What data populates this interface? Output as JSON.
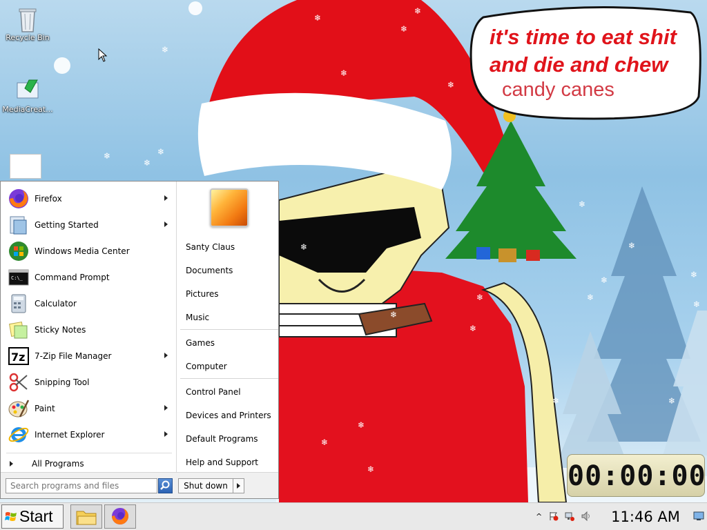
{
  "desktop": {
    "icons": [
      {
        "label": "Recycle Bin"
      },
      {
        "label": "MediaCreat..."
      }
    ],
    "speech_bubble": {
      "line1": "it's time to eat shit",
      "line2": "and die and chew",
      "line3": "candy canes"
    },
    "timer_gadget": {
      "display": "00:00:00"
    }
  },
  "start_menu": {
    "programs": [
      {
        "label": "Firefox",
        "submenu": true
      },
      {
        "label": "Getting Started",
        "submenu": true
      },
      {
        "label": "Windows Media Center",
        "submenu": false
      },
      {
        "label": "Command Prompt",
        "submenu": false
      },
      {
        "label": "Calculator",
        "submenu": false
      },
      {
        "label": "Sticky Notes",
        "submenu": false
      },
      {
        "label": "7-Zip File Manager",
        "submenu": true
      },
      {
        "label": "Snipping Tool",
        "submenu": false
      },
      {
        "label": "Paint",
        "submenu": true
      },
      {
        "label": "Internet Explorer",
        "submenu": true
      }
    ],
    "all_programs": "All Programs",
    "search_placeholder": "Search programs and files",
    "shutdown_label": "Shut down",
    "places": [
      "Santy Claus",
      "Documents",
      "Pictures",
      "Music",
      "Games",
      "Computer",
      "Control Panel",
      "Devices and Printers",
      "Default Programs",
      "Help and Support"
    ]
  },
  "taskbar": {
    "start_label": "Start",
    "clock": "11:46 AM"
  },
  "colors": {
    "bubble_text": "#e0141b",
    "menu_bg": "#ffffff",
    "taskbar_bg": "#e9e9e9"
  }
}
